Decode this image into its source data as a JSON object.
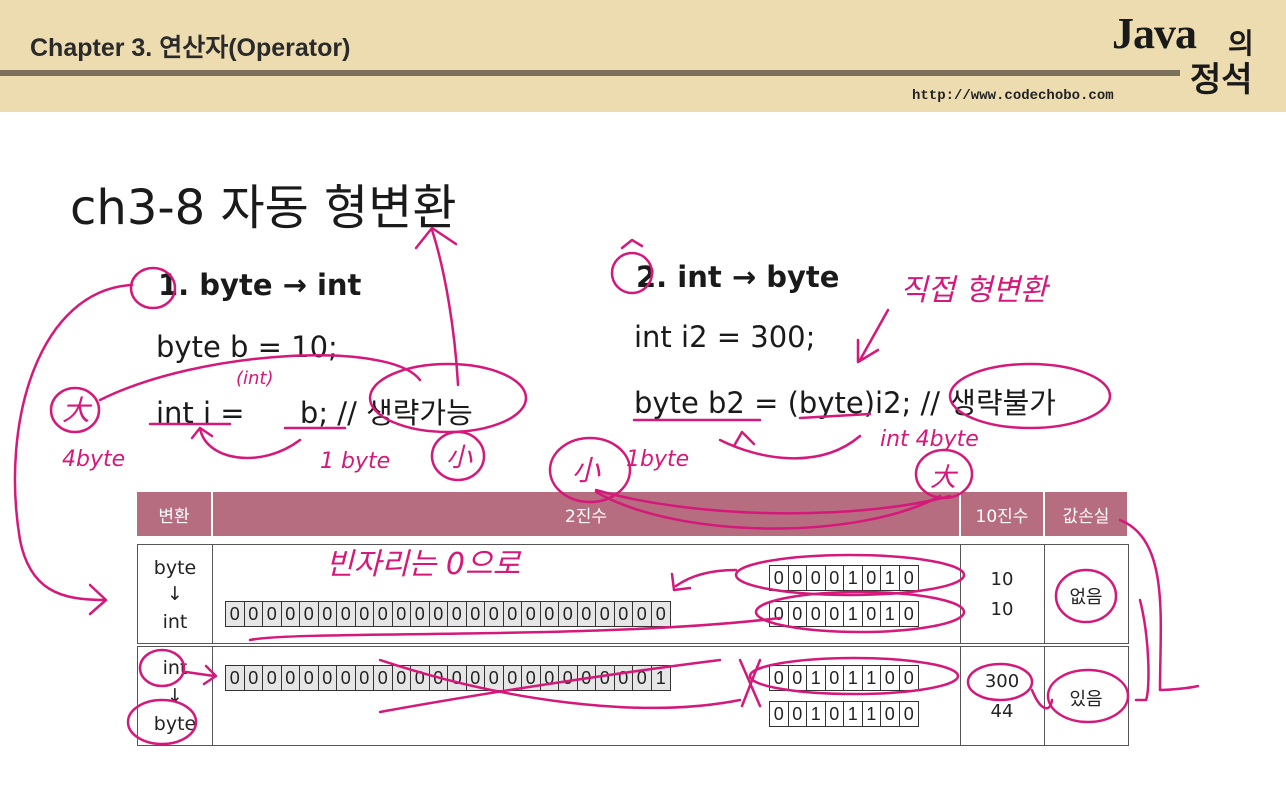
{
  "header": {
    "title": "Chapter 3. 연산자(Operator)",
    "url": "http://www.codechobo.com",
    "logo": {
      "java": "Java",
      "ui": "의",
      "jeongseok": "정석"
    }
  },
  "slide": {
    "title": "ch3-8 자동 형변환",
    "left": {
      "heading": "1. byte → int",
      "line1": "byte b = 10;",
      "line2": "int i =      b; // 생략가능"
    },
    "right": {
      "heading": "2. int → byte",
      "line1": "int i2 = 300;",
      "line2": "byte b2 = (byte)i2; // 생략불가"
    }
  },
  "table": {
    "headers": [
      "변환",
      "2진수",
      "10진수",
      "값손실"
    ],
    "rows": [
      {
        "type_from": "byte",
        "arrow": "↓",
        "type_to": "int",
        "bits_top": [
          "0",
          "0",
          "0",
          "0",
          "1",
          "0",
          "1",
          "0"
        ],
        "bits_bottom_prefix": [
          "0",
          "0",
          "0",
          "0",
          "0",
          "0",
          "0",
          "0",
          "0",
          "0",
          "0",
          "0",
          "0",
          "0",
          "0",
          "0",
          "0",
          "0",
          "0",
          "0",
          "0",
          "0",
          "0",
          "0"
        ],
        "bits_bottom_suffix": [
          "0",
          "0",
          "0",
          "0",
          "1",
          "0",
          "1",
          "0"
        ],
        "dec_top": "10",
        "dec_bottom": "10",
        "loss": "없음"
      },
      {
        "type_from": "int",
        "arrow": "↓",
        "type_to": "byte",
        "bits_top_prefix": [
          "0",
          "0",
          "0",
          "0",
          "0",
          "0",
          "0",
          "0",
          "0",
          "0",
          "0",
          "0",
          "0",
          "0",
          "0",
          "0",
          "0",
          "0",
          "0",
          "0",
          "0",
          "0",
          "0",
          "1"
        ],
        "bits_top_suffix": [
          "0",
          "0",
          "1",
          "0",
          "1",
          "1",
          "0",
          "0"
        ],
        "bits_bottom": [
          "0",
          "0",
          "1",
          "0",
          "1",
          "1",
          "0",
          "0"
        ],
        "dec_top": "300",
        "dec_bottom": "44",
        "loss": "있음"
      }
    ]
  },
  "annotations": {
    "int_cast": "(int)",
    "four_byte_left": "4byte",
    "one_byte_small": "1 byte",
    "small_char": "小",
    "big_char": "大",
    "direct_cast": "직접 형변환",
    "one_byte_right": "1byte",
    "int_four_byte": "int 4byte",
    "fill_zero": "빈자리는 0으로",
    "ink_color": "#d4197a"
  }
}
